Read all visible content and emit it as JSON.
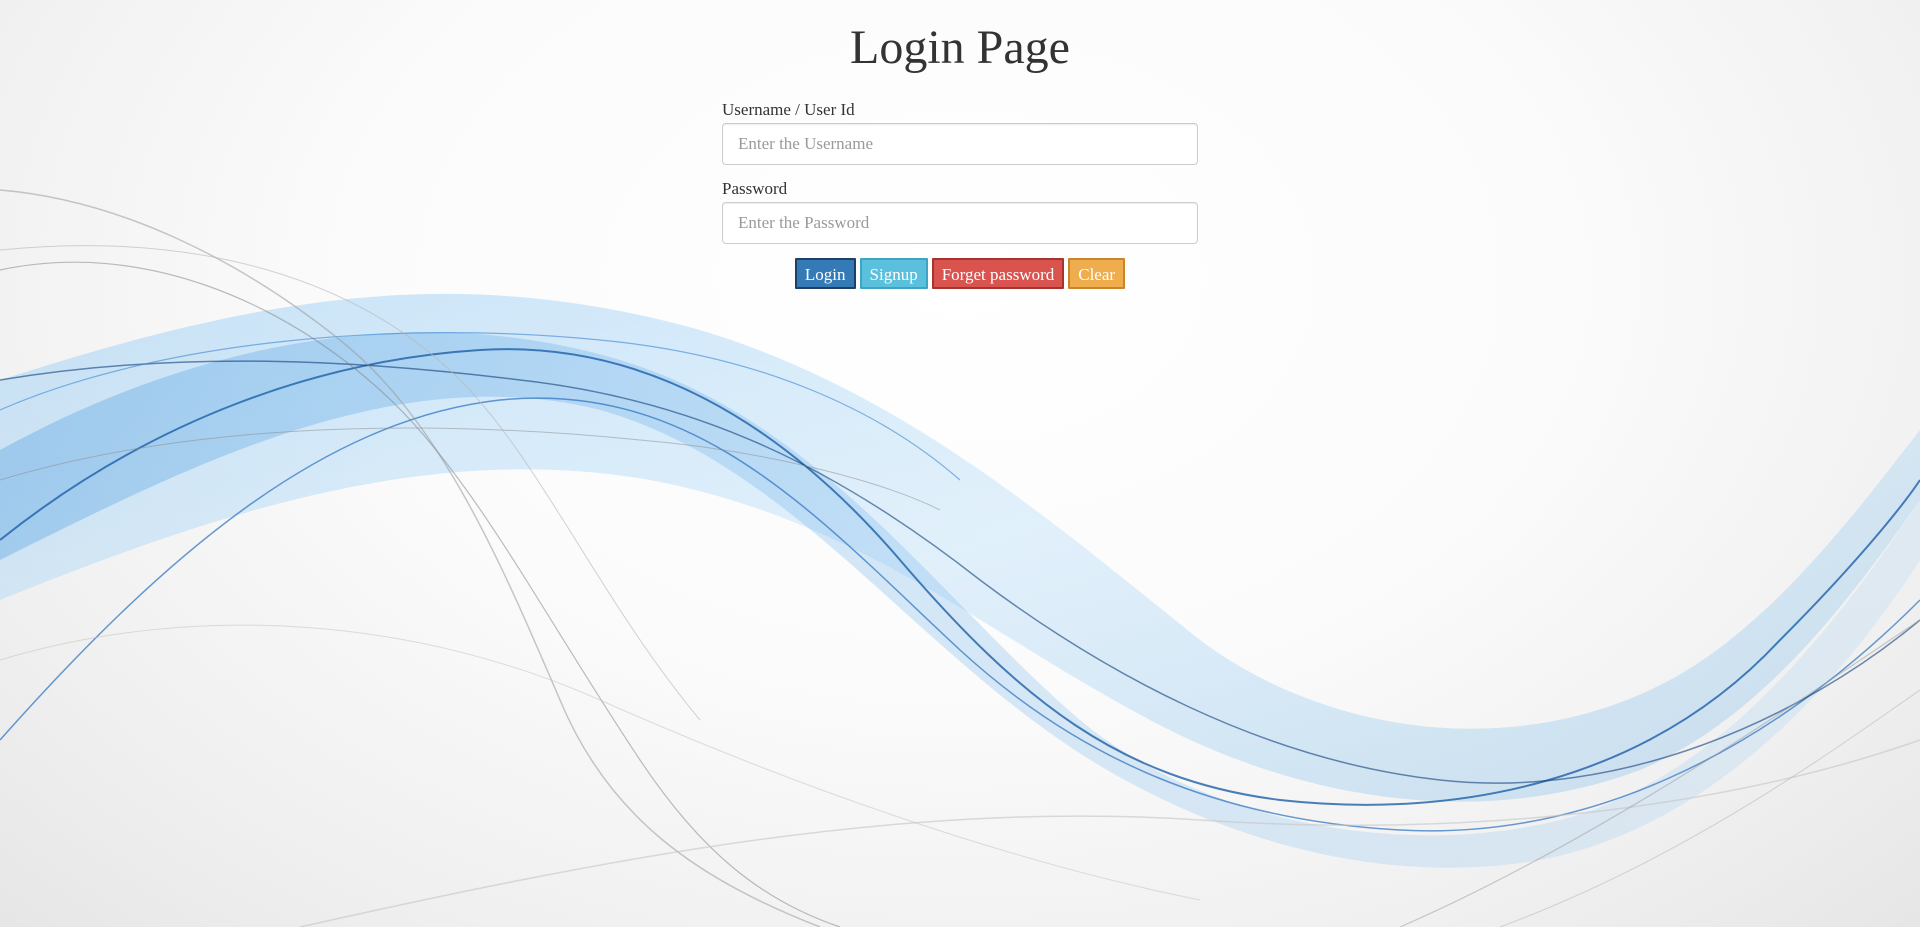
{
  "page": {
    "title": "Login Page"
  },
  "form": {
    "username": {
      "label": "Username / User Id",
      "value": "",
      "placeholder": "Enter the Username"
    },
    "password": {
      "label": "Password",
      "value": "",
      "placeholder": "Enter the Password"
    }
  },
  "buttons": {
    "login": "Login",
    "signup": "Signup",
    "forget_password": "Forget password",
    "clear": "Clear"
  },
  "colors": {
    "login_button": "#337ab7",
    "signup_button": "#5bc0de",
    "forget_button": "#d9534f",
    "clear_button": "#f0ad4e",
    "wave_blue": "#1f78c8",
    "wave_gray": "#8c8c8c"
  }
}
